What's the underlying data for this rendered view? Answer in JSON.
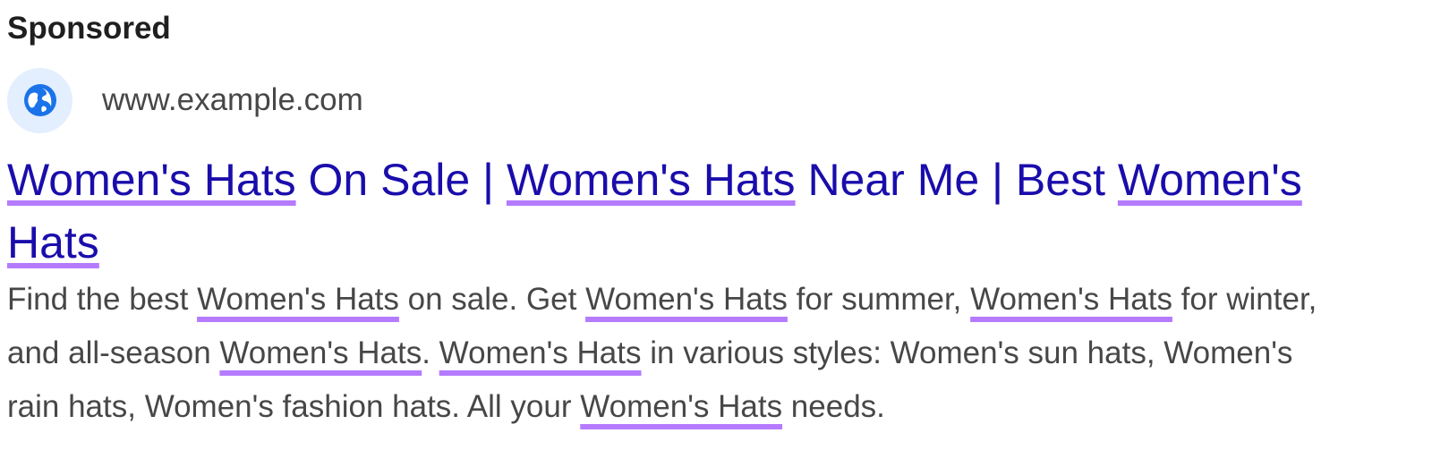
{
  "ad": {
    "label": "Sponsored",
    "display_url": "www.example.com",
    "favicon_icon": "globe-icon",
    "headline": [
      "Women's Hats",
      " On Sale | ",
      "Women's Hats",
      " Near Me | Best ",
      "Women's",
      "Hats"
    ],
    "description": [
      "Find the best ",
      "Women's Hats",
      " on sale. Get ",
      "Women's Hats",
      " for summer, ",
      "Women's Hats",
      " for winter,",
      "and all-season ",
      "Women's Hats",
      ". ",
      "Women's Hats",
      " in various styles: Women's sun hats, Women's",
      "rain hats, Women's fashion hats. All your ",
      "Women's Hats",
      " needs."
    ]
  },
  "colors": {
    "headline": "#1a0dab",
    "keyword_underline": "#b57bff",
    "body_text": "#474747",
    "favicon_bg": "#e3eefe",
    "favicon": "#1a73e8"
  }
}
